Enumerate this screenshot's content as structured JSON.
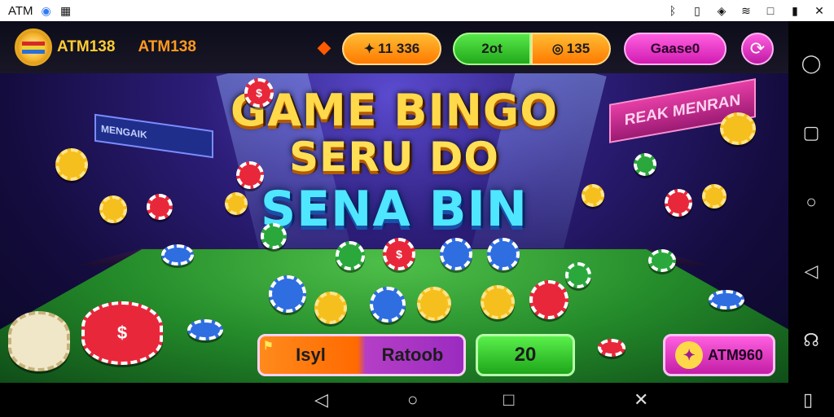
{
  "status_bar": {
    "app_label": "ATM",
    "left_icons": [
      "browser-icon",
      "qr-icon"
    ],
    "right_icons": [
      "bluetooth-icon",
      "vibrate-icon",
      "location-icon",
      "wifi-icon",
      "square-icon",
      "battery-icon",
      "close-icon"
    ]
  },
  "header": {
    "brand_name": "ATM138",
    "brand_name_2": "ATM138",
    "balance_pill": "11 336",
    "green_pill": "2ot",
    "orange_pill_2": "135",
    "pink_pill": "Gaase0",
    "refresh_icon": "refresh-icon"
  },
  "hero": {
    "line1": "GAME BINGO",
    "line2": "SERU DO",
    "line3": "SENA BIN",
    "banner_left": "MENGAIK",
    "banner_right": "REAK MENRAN"
  },
  "bottom_controls": {
    "left_segment": "Isyl",
    "right_segment": "Ratoob",
    "number_box": "20",
    "cta_label": "ATM960"
  },
  "nav": {
    "side": [
      "circle-icon",
      "square-icon",
      "circle-icon",
      "back-icon",
      "headset-icon"
    ],
    "bottom": [
      "back-icon",
      "home-icon",
      "recents-icon",
      "close-icon",
      "square-icon"
    ]
  },
  "colors": {
    "accent_orange": "#ff7a00",
    "accent_green": "#22a91b",
    "accent_pink": "#d21cb2",
    "title_yellow": "#ffd94a",
    "title_cyan": "#4fe6ff"
  }
}
